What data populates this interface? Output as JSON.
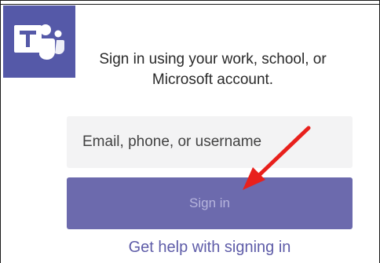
{
  "logo": {
    "icon": "microsoft-teams-logo-icon",
    "color": "#5559a8"
  },
  "prompt": {
    "line1": "Sign in using your work, school, or",
    "line2": "Microsoft account."
  },
  "login": {
    "placeholder": "Email, phone, or username",
    "value": ""
  },
  "signin_button": {
    "label": "Sign in",
    "color": "#6c6aad"
  },
  "help_link": {
    "label": "Get help with signing in",
    "color": "#5e5ca8"
  },
  "annotation": {
    "icon": "red-arrow-icon",
    "color": "#e8201c"
  }
}
